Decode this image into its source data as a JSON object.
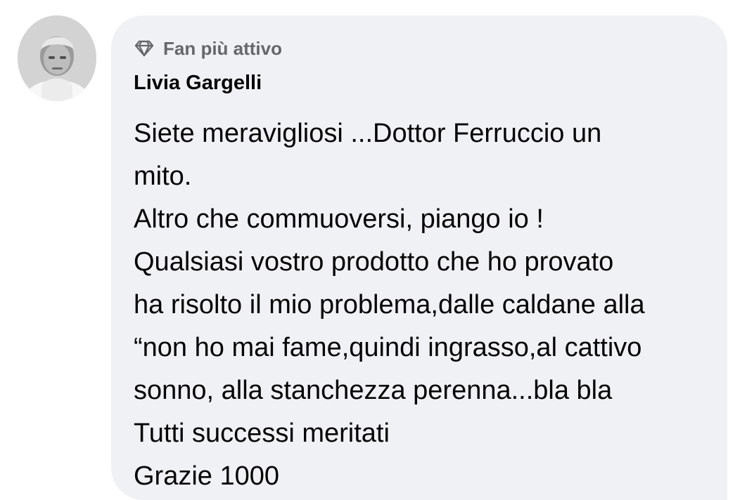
{
  "comment": {
    "avatar_icon": "profile-photo",
    "badge_icon": "diamond-icon",
    "badge_label": "Fan più attivo",
    "author_name": "Livia Gargelli",
    "lines": [
      "Siete meravigliosi ...Dottor Ferruccio un",
      "mito.",
      "Altro che commuoversi, piango io !",
      "Qualsiasi vostro prodotto che ho provato",
      "ha risolto il mio problema,dalle caldane alla",
      "“non ho mai fame,quindi ingrasso,al cattivo",
      "sonno, alla stanchezza perenna...bla bla",
      "Tutti successi meritati",
      "Grazie 1000"
    ]
  },
  "colors": {
    "bubble_background": "#f0f1f4",
    "badge_text": "#65676b",
    "primary_text": "#050505"
  }
}
